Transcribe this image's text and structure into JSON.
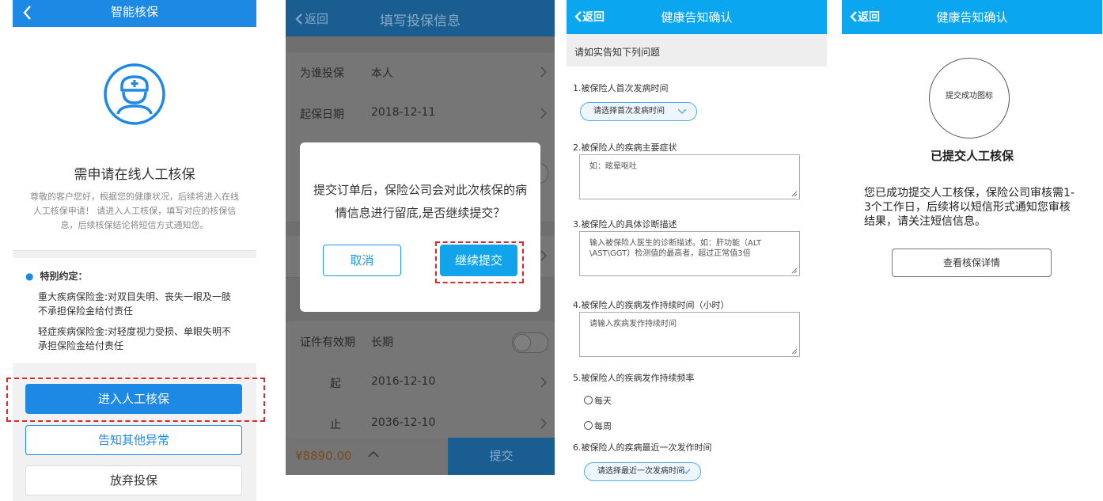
{
  "panel1": {
    "title": "智能核保",
    "headline": "需申请在线人工核保",
    "description": "尊敬的客户您好，根据您的健康状况，后续将进入在线人工核保申请！ 请进入人工核保，填写对应的核保信息，后续核保结论将短信方式通知您。",
    "terms": {
      "title": "特别约定：",
      "items": [
        "重大疾病保险金:对双目失明、丧失一眼及一肢不承担保险金给付责任",
        "轻症疾病保险金:对轻度视力受损、单眼失明不承担保险金给付责任"
      ]
    },
    "buttons": {
      "primary": "进入人工核保",
      "secondary": "告知其他异常",
      "tertiary": "放弃投保"
    },
    "colors": {
      "accent": "#1e88e5",
      "highlight": "#e0252b"
    }
  },
  "panel2": {
    "back_label": "返回",
    "title": "填写投保信息",
    "rows": {
      "insured": {
        "label": "为谁投保",
        "value": "本人"
      },
      "start_date": {
        "label": "起保日期",
        "value": "2018-12-11"
      },
      "id_validity": {
        "label": "证件有效期",
        "value": "长期"
      },
      "from": {
        "label": "起",
        "value": "2016-12-10"
      },
      "to": {
        "label": "止",
        "value": "2036-12-10"
      }
    },
    "price": "¥8890.00",
    "submit_label": "提交",
    "modal": {
      "message": "提交订单后，保险公司会对此次核保的病情信息进行留底,是否继续提交？",
      "cancel_label": "取消",
      "confirm_label": "继续提交"
    }
  },
  "panel3": {
    "back_label": "返回",
    "title": "健康告知确认",
    "banner": "请如实告知下列问题",
    "questions": {
      "q1": {
        "text": "1.被保险人首次发病时间",
        "select": "请选择首次发病时间"
      },
      "q2": {
        "text": "2.被保险人的疾病主要症状",
        "placeholder": "如：眩晕呕吐"
      },
      "q3": {
        "text": "3.被保险人的具体诊断描述",
        "placeholder": "输入被保险人医生的诊断描述。如：肝功能（ALT\n\\AST\\GGT）检测值的最高者，超过正常值3倍"
      },
      "q4": {
        "text": "4.被保险人的疾病发作持续时间（小时）",
        "placeholder": "请输入疾病发作持续时间"
      },
      "q5": {
        "text": "5.被保险人的疾病发作持续频率",
        "options": [
          "每天",
          "每周"
        ]
      },
      "q6": {
        "text": "6.被保险人的疾病最近一次发作时间",
        "select": "请选择最近一次发病时间"
      }
    },
    "colors": {
      "header": "#0aa6f0"
    }
  },
  "panel4": {
    "back_label": "返回",
    "title": "健康告知确认",
    "icon_caption": "提交成功图标",
    "done_title": "已提交人工核保",
    "done_desc": "您已成功提交人工核保，保险公司审核需1-3个工作日，后续将以短信形式通知您审核结果，请关注短信信息。",
    "detail_button": "查看核保详情"
  }
}
